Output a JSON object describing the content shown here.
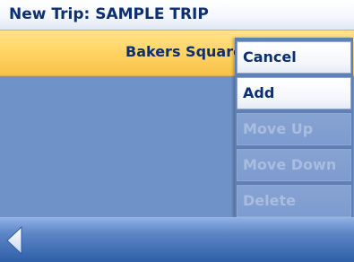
{
  "header": {
    "title": "New Trip: SAMPLE TRIP"
  },
  "list": {
    "items": [
      {
        "label": "Bakers Square"
      }
    ]
  },
  "menu": {
    "items": [
      {
        "label": "Cancel",
        "enabled": true
      },
      {
        "label": "Add",
        "enabled": true
      },
      {
        "label": "Move Up",
        "enabled": false
      },
      {
        "label": "Move Down",
        "enabled": false
      },
      {
        "label": "Delete",
        "enabled": false
      }
    ]
  },
  "footer": {
    "back_icon": "chevron-left-icon"
  },
  "colors": {
    "header_bg": "#ffffff",
    "title_text": "#0b2f72",
    "content_bg": "#6f93c9",
    "selected_row": "#ffd25f",
    "menu_enabled": "#ffffff",
    "menu_disabled": "#7e9bd0",
    "disabled_text": "#a8bde0",
    "footer_bar": "#2f5fa7"
  }
}
